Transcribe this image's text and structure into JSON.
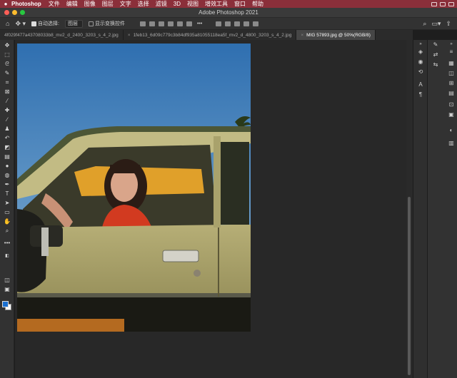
{
  "menubar": {
    "app": "Photoshop",
    "items": [
      "文件",
      "编辑",
      "图像",
      "图层",
      "文字",
      "选择",
      "滤镜",
      "3D",
      "视图",
      "增效工具",
      "窗口",
      "帮助"
    ]
  },
  "window": {
    "title": "Adobe Photoshop 2021"
  },
  "options": {
    "auto_select_label": "自动选择:",
    "auto_select_value": "图层",
    "show_transform_label": "显示变换控件"
  },
  "tabs": [
    {
      "label": "4f029f477a43708033b8_mv2_d_2400_3203_s_4_2.jpg",
      "active": false
    },
    {
      "label": "1feb13_6d09c779c3b84df935a81055118ea5f_mv2_d_4800_3203_s_4_2.jpg",
      "active": false
    },
    {
      "label": "MIG 57893.jpg @ 50%(RGB/8)",
      "active": true
    }
  ],
  "colors": {
    "menubar_bg": "#8b2f3a",
    "foreground": "#1a6fd0",
    "background": "#ffffff"
  },
  "tools": [
    "move-tool",
    "marquee-tool",
    "lasso-tool",
    "quick-select-tool",
    "crop-tool",
    "frame-tool",
    "eyedropper-tool",
    "healing-tool",
    "brush-tool",
    "stamp-tool",
    "history-brush-tool",
    "eraser-tool",
    "gradient-tool",
    "blur-tool",
    "dodge-tool",
    "pen-tool",
    "type-tool",
    "path-select-tool",
    "rectangle-tool",
    "hand-tool",
    "zoom-tool",
    "more-tools"
  ]
}
